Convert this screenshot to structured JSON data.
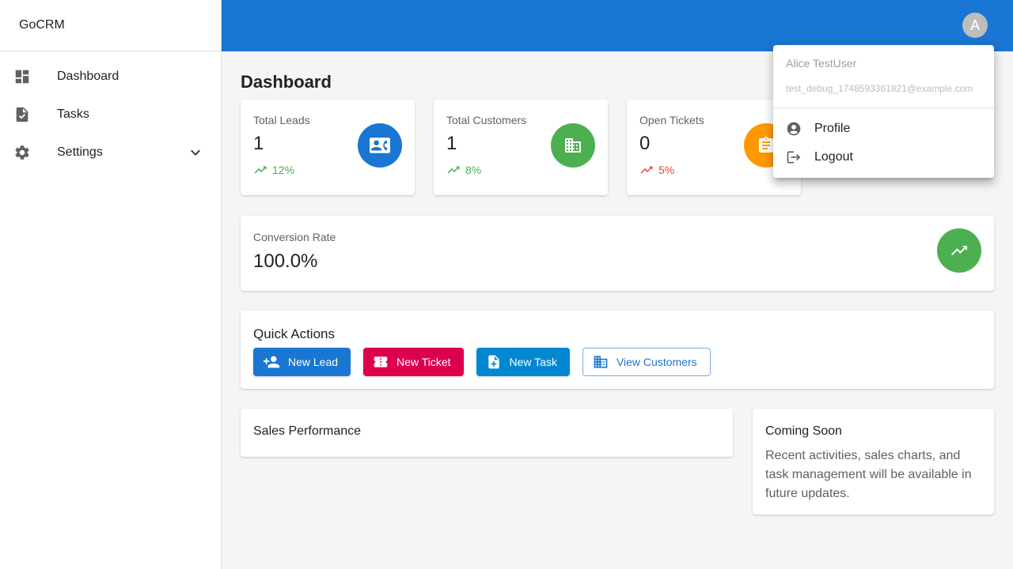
{
  "app": {
    "brand": "GoCRM"
  },
  "sidebar": {
    "items": [
      {
        "label": "Dashboard",
        "icon": "dashboard-icon"
      },
      {
        "label": "Tasks",
        "icon": "task-icon"
      },
      {
        "label": "Settings",
        "icon": "gear-icon"
      }
    ]
  },
  "header": {
    "avatar_initial": "A"
  },
  "main": {
    "title": "Dashboard",
    "stats": [
      {
        "title": "Total Leads",
        "value": "1",
        "trend": "12%",
        "trend_direction": "up",
        "trend_color": "#4caf50",
        "circle_color": "#1976d2",
        "icon": "contact-card-icon"
      },
      {
        "title": "Total Customers",
        "value": "1",
        "trend": "8%",
        "trend_direction": "up",
        "trend_color": "#4caf50",
        "circle_color": "#4caf50",
        "icon": "building-icon"
      },
      {
        "title": "Open Tickets",
        "value": "0",
        "trend": "5%",
        "trend_direction": "up",
        "trend_color": "#f44336",
        "circle_color": "#ff9800",
        "icon": "clipboard-icon"
      }
    ],
    "conversion": {
      "title": "Conversion Rate",
      "value": "100.0%",
      "icon": "trending-up-icon"
    },
    "quick_actions": {
      "title": "Quick Actions",
      "buttons": [
        {
          "label": "New Lead",
          "icon": "person-add-icon",
          "color": "#1976d2"
        },
        {
          "label": "New Ticket",
          "icon": "ticket-icon",
          "color": "#dc004e"
        },
        {
          "label": "New Task",
          "icon": "note-add-icon",
          "color": "#0288d1"
        },
        {
          "label": "View Customers",
          "icon": "building-icon",
          "color": "#1976d2"
        }
      ]
    },
    "sales": {
      "title": "Sales Performance"
    },
    "coming_soon": {
      "title": "Coming Soon",
      "text": "Recent activities, sales charts, and task management will be available in future updates."
    }
  },
  "user_menu": {
    "name": "Alice TestUser",
    "email": "test_debug_1748593361821@example.com",
    "items": [
      {
        "label": "Profile",
        "icon": "account-circle-icon"
      },
      {
        "label": "Logout",
        "icon": "logout-icon"
      }
    ]
  }
}
